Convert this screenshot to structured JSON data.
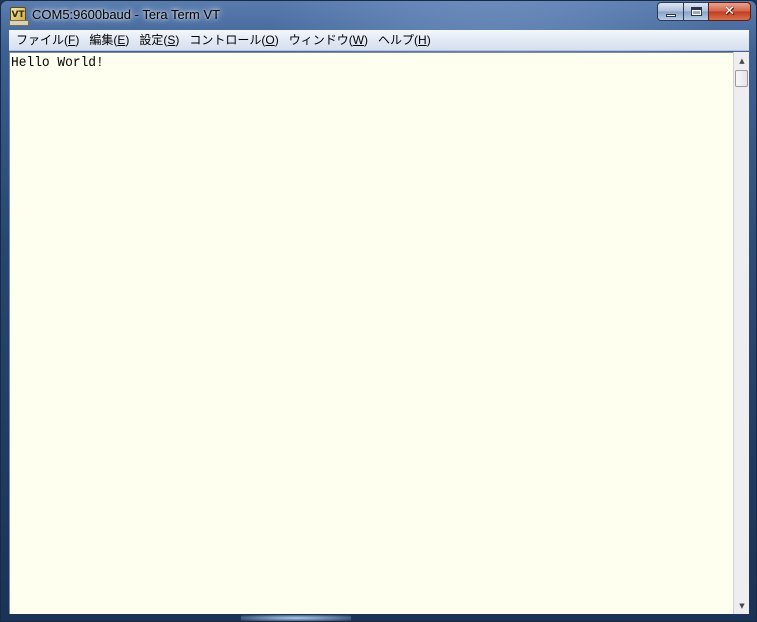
{
  "window": {
    "title": "COM5:9600baud - Tera Term VT",
    "app_icon_glyph": "VT",
    "controls": {
      "minimize_icon": "minimize-icon",
      "maximize_icon": "maximize-icon",
      "close_glyph": "✕"
    }
  },
  "menu": {
    "items": [
      {
        "label": "ファイル(",
        "accel": "F",
        "suffix": ")"
      },
      {
        "label": "編集(",
        "accel": "E",
        "suffix": ")"
      },
      {
        "label": "設定(",
        "accel": "S",
        "suffix": ")"
      },
      {
        "label": "コントロール(",
        "accel": "O",
        "suffix": ")"
      },
      {
        "label": "ウィンドウ(",
        "accel": "W",
        "suffix": ")"
      },
      {
        "label": "ヘルプ(",
        "accel": "H",
        "suffix": ")"
      }
    ]
  },
  "terminal": {
    "text": "Hello World!",
    "background": "#fffff0",
    "foreground": "#000000"
  },
  "scrollbar": {
    "up_glyph": "▲",
    "down_glyph": "▼"
  }
}
